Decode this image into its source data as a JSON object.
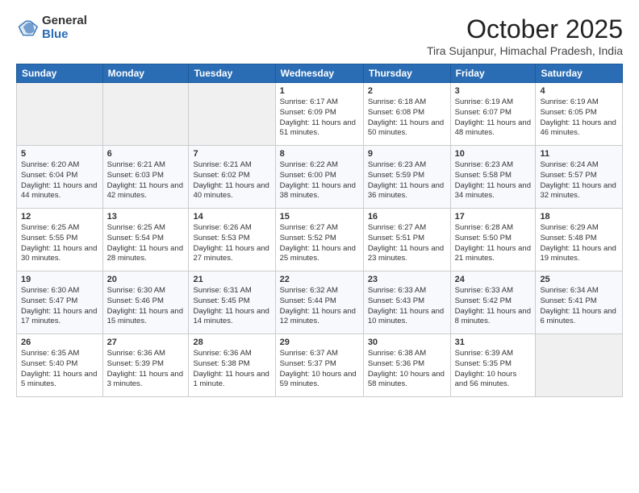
{
  "logo": {
    "general": "General",
    "blue": "Blue"
  },
  "header": {
    "month": "October 2025",
    "location": "Tira Sujanpur, Himachal Pradesh, India"
  },
  "weekdays": [
    "Sunday",
    "Monday",
    "Tuesday",
    "Wednesday",
    "Thursday",
    "Friday",
    "Saturday"
  ],
  "weeks": [
    [
      {
        "day": "",
        "text": ""
      },
      {
        "day": "",
        "text": ""
      },
      {
        "day": "",
        "text": ""
      },
      {
        "day": "1",
        "text": "Sunrise: 6:17 AM\nSunset: 6:09 PM\nDaylight: 11 hours and 51 minutes."
      },
      {
        "day": "2",
        "text": "Sunrise: 6:18 AM\nSunset: 6:08 PM\nDaylight: 11 hours and 50 minutes."
      },
      {
        "day": "3",
        "text": "Sunrise: 6:19 AM\nSunset: 6:07 PM\nDaylight: 11 hours and 48 minutes."
      },
      {
        "day": "4",
        "text": "Sunrise: 6:19 AM\nSunset: 6:05 PM\nDaylight: 11 hours and 46 minutes."
      }
    ],
    [
      {
        "day": "5",
        "text": "Sunrise: 6:20 AM\nSunset: 6:04 PM\nDaylight: 11 hours and 44 minutes."
      },
      {
        "day": "6",
        "text": "Sunrise: 6:21 AM\nSunset: 6:03 PM\nDaylight: 11 hours and 42 minutes."
      },
      {
        "day": "7",
        "text": "Sunrise: 6:21 AM\nSunset: 6:02 PM\nDaylight: 11 hours and 40 minutes."
      },
      {
        "day": "8",
        "text": "Sunrise: 6:22 AM\nSunset: 6:00 PM\nDaylight: 11 hours and 38 minutes."
      },
      {
        "day": "9",
        "text": "Sunrise: 6:23 AM\nSunset: 5:59 PM\nDaylight: 11 hours and 36 minutes."
      },
      {
        "day": "10",
        "text": "Sunrise: 6:23 AM\nSunset: 5:58 PM\nDaylight: 11 hours and 34 minutes."
      },
      {
        "day": "11",
        "text": "Sunrise: 6:24 AM\nSunset: 5:57 PM\nDaylight: 11 hours and 32 minutes."
      }
    ],
    [
      {
        "day": "12",
        "text": "Sunrise: 6:25 AM\nSunset: 5:55 PM\nDaylight: 11 hours and 30 minutes."
      },
      {
        "day": "13",
        "text": "Sunrise: 6:25 AM\nSunset: 5:54 PM\nDaylight: 11 hours and 28 minutes."
      },
      {
        "day": "14",
        "text": "Sunrise: 6:26 AM\nSunset: 5:53 PM\nDaylight: 11 hours and 27 minutes."
      },
      {
        "day": "15",
        "text": "Sunrise: 6:27 AM\nSunset: 5:52 PM\nDaylight: 11 hours and 25 minutes."
      },
      {
        "day": "16",
        "text": "Sunrise: 6:27 AM\nSunset: 5:51 PM\nDaylight: 11 hours and 23 minutes."
      },
      {
        "day": "17",
        "text": "Sunrise: 6:28 AM\nSunset: 5:50 PM\nDaylight: 11 hours and 21 minutes."
      },
      {
        "day": "18",
        "text": "Sunrise: 6:29 AM\nSunset: 5:48 PM\nDaylight: 11 hours and 19 minutes."
      }
    ],
    [
      {
        "day": "19",
        "text": "Sunrise: 6:30 AM\nSunset: 5:47 PM\nDaylight: 11 hours and 17 minutes."
      },
      {
        "day": "20",
        "text": "Sunrise: 6:30 AM\nSunset: 5:46 PM\nDaylight: 11 hours and 15 minutes."
      },
      {
        "day": "21",
        "text": "Sunrise: 6:31 AM\nSunset: 5:45 PM\nDaylight: 11 hours and 14 minutes."
      },
      {
        "day": "22",
        "text": "Sunrise: 6:32 AM\nSunset: 5:44 PM\nDaylight: 11 hours and 12 minutes."
      },
      {
        "day": "23",
        "text": "Sunrise: 6:33 AM\nSunset: 5:43 PM\nDaylight: 11 hours and 10 minutes."
      },
      {
        "day": "24",
        "text": "Sunrise: 6:33 AM\nSunset: 5:42 PM\nDaylight: 11 hours and 8 minutes."
      },
      {
        "day": "25",
        "text": "Sunrise: 6:34 AM\nSunset: 5:41 PM\nDaylight: 11 hours and 6 minutes."
      }
    ],
    [
      {
        "day": "26",
        "text": "Sunrise: 6:35 AM\nSunset: 5:40 PM\nDaylight: 11 hours and 5 minutes."
      },
      {
        "day": "27",
        "text": "Sunrise: 6:36 AM\nSunset: 5:39 PM\nDaylight: 11 hours and 3 minutes."
      },
      {
        "day": "28",
        "text": "Sunrise: 6:36 AM\nSunset: 5:38 PM\nDaylight: 11 hours and 1 minute."
      },
      {
        "day": "29",
        "text": "Sunrise: 6:37 AM\nSunset: 5:37 PM\nDaylight: 10 hours and 59 minutes."
      },
      {
        "day": "30",
        "text": "Sunrise: 6:38 AM\nSunset: 5:36 PM\nDaylight: 10 hours and 58 minutes."
      },
      {
        "day": "31",
        "text": "Sunrise: 6:39 AM\nSunset: 5:35 PM\nDaylight: 10 hours and 56 minutes."
      },
      {
        "day": "",
        "text": ""
      }
    ]
  ]
}
